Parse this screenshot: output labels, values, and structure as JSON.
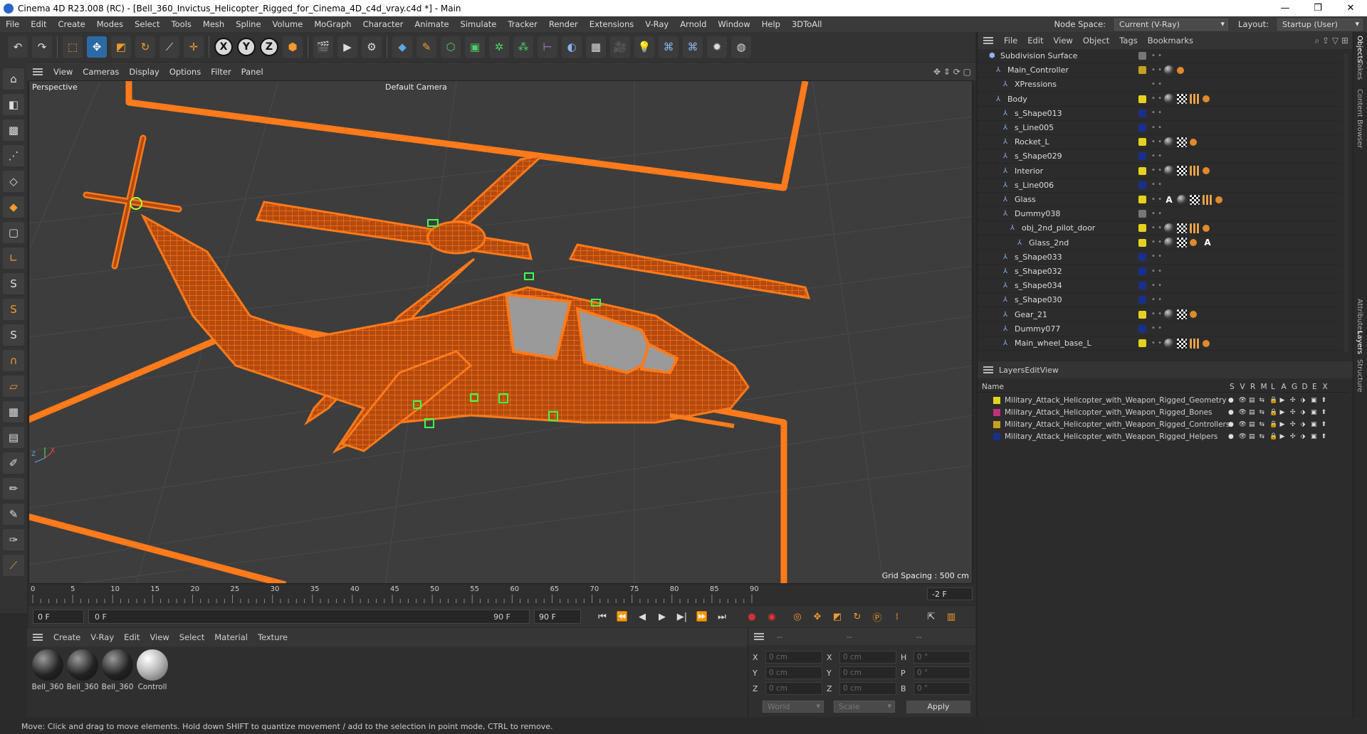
{
  "window": {
    "title": "Cinema 4D R23.008 (RC) - [Bell_360_Invictus_Helicopter_Rigged_for_Cinema_4D_c4d_vray.c4d *] - Main"
  },
  "menubar": {
    "items": [
      "File",
      "Edit",
      "Create",
      "Modes",
      "Select",
      "Tools",
      "Mesh",
      "Spline",
      "Volume",
      "MoGraph",
      "Character",
      "Animate",
      "Simulate",
      "Tracker",
      "Render",
      "Extensions",
      "V-Ray",
      "Arnold",
      "Window",
      "Help",
      "3DToAll"
    ],
    "node_space_label": "Node Space:",
    "node_space_value": "Current (V-Ray)",
    "layout_label": "Layout:",
    "layout_value": "Startup (User)"
  },
  "viewport": {
    "menu": [
      "View",
      "Cameras",
      "Display",
      "Options",
      "Filter",
      "Panel"
    ],
    "label": "Perspective",
    "camera": "Default Camera",
    "grid_spacing": "Grid Spacing : 500 cm",
    "axis_z": "Z",
    "axis_x": "X",
    "accent_color": "#ff7a1a"
  },
  "timeline": {
    "ticks": [
      "0",
      "5",
      "10",
      "15",
      "20",
      "25",
      "30",
      "35",
      "40",
      "45",
      "50",
      "55",
      "60",
      "65",
      "70",
      "75",
      "80",
      "85",
      "90"
    ],
    "current_frame_field": "-2 F",
    "start_field": "0 F",
    "range_start": "0 F",
    "range_end": "90 F",
    "end_field": "90 F"
  },
  "materials": {
    "menu": [
      "Create",
      "V-Ray",
      "Edit",
      "View",
      "Select",
      "Material",
      "Texture"
    ],
    "items": [
      "Bell_360",
      "Bell_360",
      "Bell_360",
      "Controll"
    ]
  },
  "coords": {
    "headers": [
      "--",
      "--",
      "--"
    ],
    "rows": [
      {
        "a": "X",
        "av": "0 cm",
        "b": "X",
        "bv": "0 cm",
        "c": "H",
        "cv": "0 °"
      },
      {
        "a": "Y",
        "av": "0 cm",
        "b": "Y",
        "bv": "0 cm",
        "c": "P",
        "cv": "0 °"
      },
      {
        "a": "Z",
        "av": "0 cm",
        "b": "Z",
        "bv": "0 cm",
        "c": "B",
        "cv": "0 °"
      }
    ],
    "world": "World",
    "scale": "Scale",
    "apply": "Apply"
  },
  "status": {
    "text": "Move: Click and drag to move elements. Hold down SHIFT to quantize movement / add to the selection in point mode, CTRL to remove."
  },
  "objects": {
    "menu": [
      "File",
      "Edit",
      "View",
      "Object",
      "Tags",
      "Bookmarks"
    ],
    "rows": [
      {
        "name": "Subdivision Surface",
        "layer": "#777777",
        "tags": []
      },
      {
        "name": "Main_Controller",
        "layer": "#c8a020",
        "tags": [
          "sph",
          "ora"
        ]
      },
      {
        "name": "XPressions",
        "layer": "",
        "tags": []
      },
      {
        "name": "Body",
        "layer": "#e6d21e",
        "tags": [
          "sph",
          "chk",
          "grid",
          "ora"
        ]
      },
      {
        "name": "s_Shape013",
        "layer": "#1a2f8c",
        "tags": []
      },
      {
        "name": "s_Line005",
        "layer": "#1a2f8c",
        "tags": []
      },
      {
        "name": "Rocket_L",
        "layer": "#e6d21e",
        "tags": [
          "sph",
          "chk",
          "ora"
        ]
      },
      {
        "name": "s_Shape029",
        "layer": "#1a2f8c",
        "tags": []
      },
      {
        "name": "Interior",
        "layer": "#e6d21e",
        "tags": [
          "sph",
          "chk",
          "grid",
          "ora"
        ]
      },
      {
        "name": "s_Line006",
        "layer": "#1a2f8c",
        "tags": []
      },
      {
        "name": "Glass",
        "layer": "#e6d21e",
        "tags": [
          "A",
          "sph",
          "chk",
          "grid",
          "ora"
        ]
      },
      {
        "name": "Dummy038",
        "layer": "#777777",
        "tags": []
      },
      {
        "name": "obj_2nd_pilot_door",
        "layer": "#e6d21e",
        "tags": [
          "sph",
          "chk",
          "grid",
          "ora"
        ]
      },
      {
        "name": "Glass_2nd",
        "layer": "#e6d21e",
        "tags": [
          "sph",
          "chk",
          "ora",
          "A"
        ]
      },
      {
        "name": "s_Shape033",
        "layer": "#1a2f8c",
        "tags": []
      },
      {
        "name": "s_Shape032",
        "layer": "#1a2f8c",
        "tags": []
      },
      {
        "name": "s_Shape034",
        "layer": "#1a2f8c",
        "tags": []
      },
      {
        "name": "s_Shape030",
        "layer": "#1a2f8c",
        "tags": []
      },
      {
        "name": "Gear_21",
        "layer": "#e6d21e",
        "tags": [
          "sph",
          "chk",
          "ora"
        ]
      },
      {
        "name": "Dummy077",
        "layer": "#1a2f8c",
        "tags": []
      },
      {
        "name": "Main_wheel_base_L",
        "layer": "#e6d21e",
        "tags": [
          "sph",
          "chk",
          "grid",
          "ora"
        ]
      }
    ]
  },
  "layers": {
    "menu": [
      "Layers",
      "Edit",
      "View"
    ],
    "header_name": "Name",
    "header_cols": [
      "S",
      "V",
      "R",
      "M",
      "L",
      "A",
      "G",
      "D",
      "E",
      "X"
    ],
    "rows": [
      {
        "name": "Military_Attack_Helicopter_with_Weapon_Rigged_Geometry",
        "color": "#e6d21e"
      },
      {
        "name": "Military_Attack_Helicopter_with_Weapon_Rigged_Bones",
        "color": "#c0307a"
      },
      {
        "name": "Military_Attack_Helicopter_with_Weapon_Rigged_Controllers",
        "color": "#c8a020"
      },
      {
        "name": "Military_Attack_Helicopter_with_Weapon_Rigged_Helpers",
        "color": "#1a2f8c"
      }
    ]
  },
  "right_tabs": [
    "Objects",
    "Takes",
    "Content Browser",
    "Attributes",
    "Layers",
    "Structure"
  ]
}
